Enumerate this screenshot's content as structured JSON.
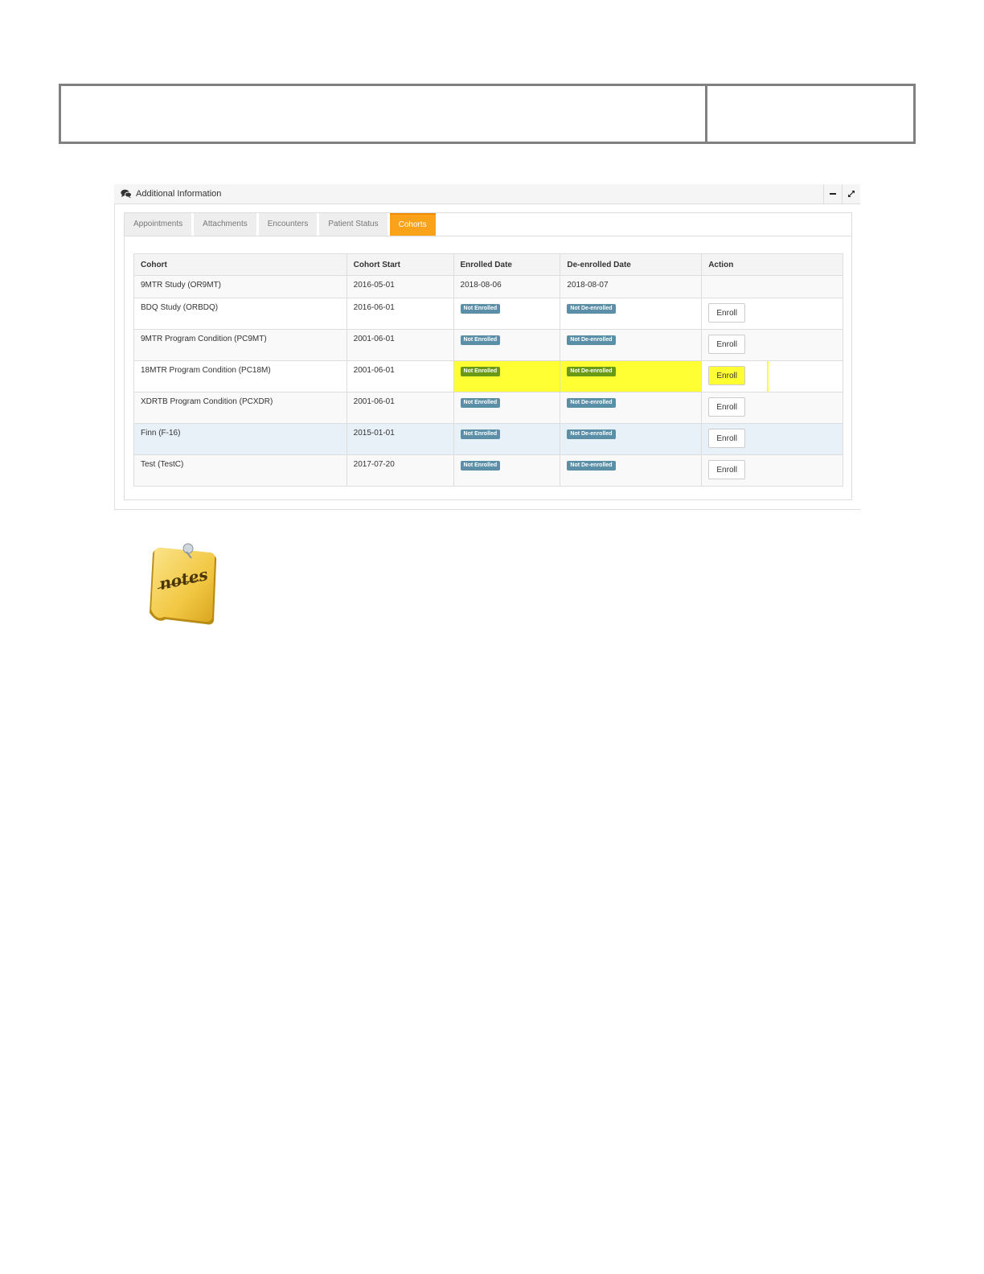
{
  "panel": {
    "title": "Additional Information",
    "icons": {
      "header": "comments-icon",
      "minimize": "minus-icon",
      "expand": "expand-icon"
    }
  },
  "tabs": [
    {
      "label": "Appointments",
      "active": false
    },
    {
      "label": "Attachments",
      "active": false
    },
    {
      "label": "Encounters",
      "active": false
    },
    {
      "label": "Patient Status",
      "active": false
    },
    {
      "label": "Cohorts",
      "active": true
    }
  ],
  "table": {
    "headers": [
      "Cohort",
      "Cohort Start",
      "Enrolled Date",
      "De-enrolled Date",
      "Action"
    ],
    "rows": [
      {
        "cohort": "9MTR Study (OR9MT)",
        "start": "2016-05-01",
        "enrolled": "2018-08-06",
        "deenrolled": "2018-08-07",
        "action": ""
      },
      {
        "cohort": "BDQ Study (ORBDQ)",
        "start": "2016-06-01",
        "enrolled": "Not Enrolled",
        "deenrolled": "Not De-enrolled",
        "action": "Enroll"
      },
      {
        "cohort": "9MTR Program Condition (PC9MT)",
        "start": "2001-06-01",
        "enrolled": "Not Enrolled",
        "deenrolled": "Not De-enrolled",
        "action": "Enroll"
      },
      {
        "cohort": "18MTR Program Condition (PC18M)",
        "start": "2001-06-01",
        "enrolled": "Not Enrolled",
        "deenrolled": "Not De-enrolled",
        "action": "Enroll"
      },
      {
        "cohort": "XDRTB Program Condition (PCXDR)",
        "start": "2001-06-01",
        "enrolled": "Not Enrolled",
        "deenrolled": "Not De-enrolled",
        "action": "Enroll"
      },
      {
        "cohort": "Finn (F-16)",
        "start": "2015-01-01",
        "enrolled": "Not Enrolled",
        "deenrolled": "Not De-enrolled",
        "action": "Enroll"
      },
      {
        "cohort": "Test (TestC)",
        "start": "2017-07-20",
        "enrolled": "Not Enrolled",
        "deenrolled": "Not De-enrolled",
        "action": "Enroll"
      }
    ]
  },
  "notes_icon": {
    "icon": "notes-icon",
    "text": "notes"
  },
  "colors": {
    "active_tab": "#f9a21a",
    "badge": "#5b8fa8",
    "highlight": "#ffff33",
    "highlight_badge": "#6a9a15"
  }
}
